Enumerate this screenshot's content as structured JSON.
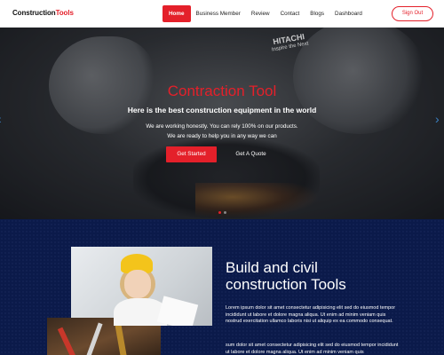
{
  "nav": {
    "logo_part1": "Construction",
    "logo_part2": "Tools",
    "items": [
      {
        "label": "Home",
        "active": true
      },
      {
        "label": "Business Member"
      },
      {
        "label": "Review"
      },
      {
        "label": "Contact"
      },
      {
        "label": "Blogs"
      },
      {
        "label": "Dashboard"
      }
    ],
    "signout_label": "Sign Out"
  },
  "hero": {
    "brand_overlay": "HITACHI",
    "brand_tagline": "Inspire the Next",
    "title": "Contraction Tool",
    "subtitle": "Here is the best construction equipment in the world",
    "line1": "We are working honestly. You can rely 100% on our products.",
    "line2": "We are ready to help you in any way we can",
    "primary_button": "Get Started",
    "secondary_button": "Get A Quote",
    "prev_arrow": "‹",
    "next_arrow": "›",
    "slides": 2,
    "active_slide": 1
  },
  "about": {
    "title_line1": "Build and civil",
    "title_line2": "construction Tools",
    "para1": "Lorem ipsum dolor sit amet consectetur adipisicing elit sed do eiusmod tempor incididunt ut labore et dolore magna aliqua. Ut enim ad minim veniam quis nostrud exercitation ullamco laboris nisi ut aliquip ex ea commodo consequat.",
    "para2": "sum dolor sit amet consectetur adipisicing elit sed do eiusmod tempor incididunt ut labore et dolore magna aliqua. Ut enim ad minim veniam quis"
  },
  "colors": {
    "accent": "#e4202a",
    "about_bg": "#0b1a4a",
    "arrow": "#3b82c4"
  }
}
